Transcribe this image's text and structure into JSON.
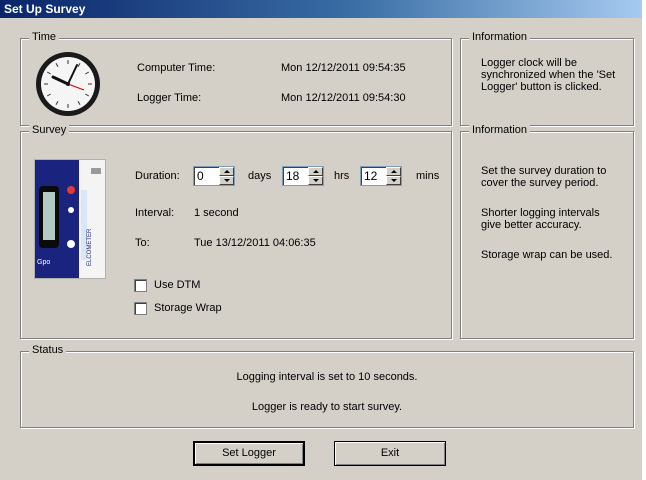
{
  "window": {
    "title": "Set Up Survey"
  },
  "time_group": {
    "legend": "Time",
    "clock_icon": "wall-clock-icon",
    "computer_time_label": "Computer Time:",
    "computer_time_value": "Mon 12/12/2011 09:54:35",
    "logger_time_label": "Logger Time:",
    "logger_time_value": "Mon 12/12/2011 09:54:30"
  },
  "info_time": {
    "legend": "Information",
    "text": "Logger clock will be synchronized when the 'Set Logger' button is clicked."
  },
  "survey_group": {
    "legend": "Survey",
    "device_image": "data-logger-device-image",
    "duration_label": "Duration:",
    "days_value": "0",
    "days_unit": "days",
    "hrs_value": "18",
    "hrs_unit": "hrs",
    "mins_value": "12",
    "mins_unit": "mins",
    "interval_label": "Interval:",
    "interval_value": "1 second",
    "to_label": "To:",
    "to_value": "Tue 13/12/2011 04:06:35",
    "use_dtm_label": "Use DTM",
    "use_dtm_checked": false,
    "storage_wrap_label": "Storage Wrap",
    "storage_wrap_checked": false
  },
  "info_survey": {
    "legend": "Information",
    "line1": "Set the survey duration to cover the survey period.",
    "line2": "Shorter logging intervals give better accuracy.",
    "line3": "Storage wrap can be used."
  },
  "status_group": {
    "legend": "Status",
    "line1": "Logging interval is set to 10 seconds.",
    "line2": "Logger is ready to start survey."
  },
  "buttons": {
    "set_logger": "Set Logger",
    "exit": "Exit"
  },
  "device_text": {
    "brand": "ELCOMETER",
    "badge": "Gpo"
  },
  "colors": {
    "titlebar_start": "#0a246a",
    "titlebar_end": "#a6caf0",
    "dialog_bg": "#d4d0c8",
    "device_blue": "#1a237e"
  }
}
